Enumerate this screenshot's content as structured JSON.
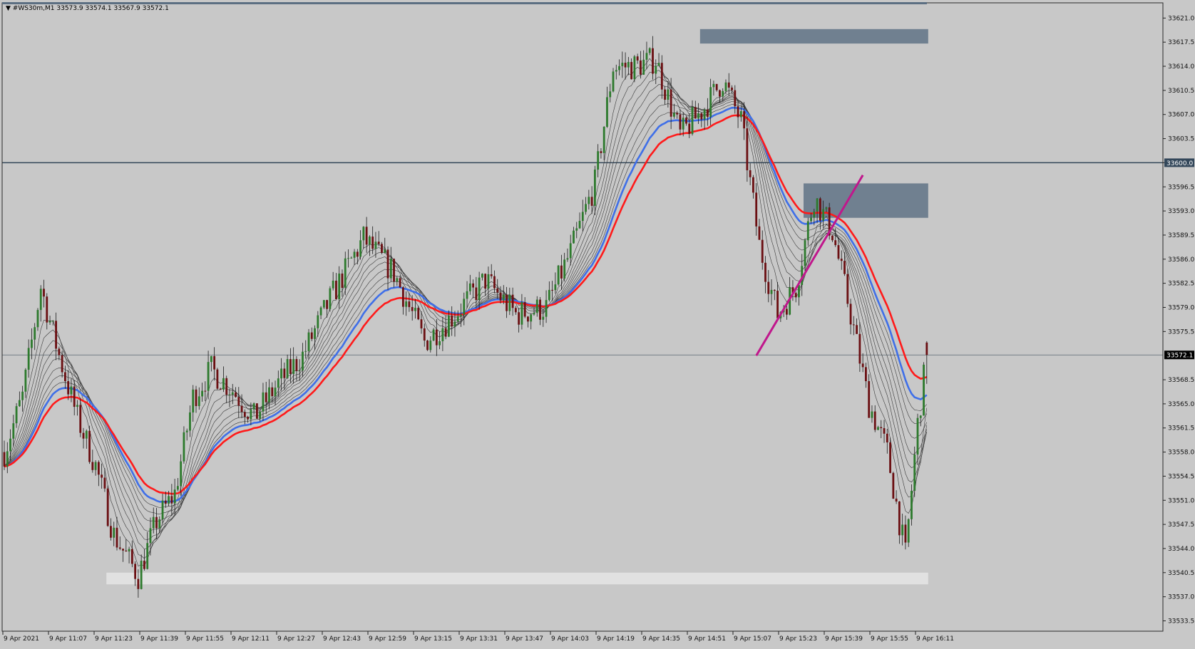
{
  "window": {
    "header": "▼ #WS30m,M1  33573.9 33574.1 33567.9 33572.1"
  },
  "price_axis": {
    "ticks": [
      "33621.0",
      "33617.5",
      "33614.0",
      "33610.5",
      "33607.0",
      "33603.5",
      "33600.0",
      "33596.5",
      "33593.0",
      "33589.5",
      "33586.0",
      "33582.5",
      "33579.0",
      "33575.5",
      "33572.1",
      "33568.5",
      "33565.0",
      "33561.5",
      "33558.0",
      "33554.5",
      "33551.0",
      "33547.5",
      "33544.0",
      "33540.5",
      "33537.0",
      "33533.5"
    ],
    "horizontal_line_label": "33600.0",
    "current_price_label": "33572.1"
  },
  "time_axis": {
    "ticks": [
      "9 Apr 2021",
      "9 Apr 11:07",
      "9 Apr 11:23",
      "9 Apr 11:39",
      "9 Apr 11:55",
      "9 Apr 12:11",
      "9 Apr 12:27",
      "9 Apr 12:43",
      "9 Apr 12:59",
      "9 Apr 13:15",
      "9 Apr 13:31",
      "9 Apr 13:47",
      "9 Apr 14:03",
      "9 Apr 14:19",
      "9 Apr 14:35",
      "9 Apr 14:51",
      "9 Apr 15:07",
      "9 Apr 15:23",
      "9 Apr 15:39",
      "9 Apr 15:55",
      "9 Apr 16:11"
    ]
  },
  "colors": {
    "background": "#c8c8c8",
    "bull_candle": "#2d7a2d",
    "bear_candle": "#6b0f12",
    "ema_red": "#ff1a1a",
    "ema_blue": "#3f6fe8",
    "ma_thin": "#3a3a3a",
    "zone": "#708090",
    "trendline": "#c0178c",
    "level_line": "#33475a",
    "support_zone": "#e1e1e1"
  },
  "chart_data": {
    "type": "candlestick",
    "symbol": "#WS30m",
    "timeframe": "M1",
    "last_bar": {
      "open": 33573.9,
      "high": 33574.1,
      "low": 33567.9,
      "close": 33572.1
    },
    "ylim": [
      33532.0,
      33623.0
    ],
    "key_points": [
      {
        "t": 0,
        "p": 33558
      },
      {
        "t": 6,
        "p": 33566
      },
      {
        "t": 12,
        "p": 33582
      },
      {
        "t": 18,
        "p": 33572
      },
      {
        "t": 24,
        "p": 33563
      },
      {
        "t": 30,
        "p": 33556
      },
      {
        "t": 36,
        "p": 33546
      },
      {
        "t": 44,
        "p": 33540
      },
      {
        "t": 50,
        "p": 33548
      },
      {
        "t": 56,
        "p": 33552
      },
      {
        "t": 62,
        "p": 33566
      },
      {
        "t": 68,
        "p": 33570
      },
      {
        "t": 75,
        "p": 33567
      },
      {
        "t": 82,
        "p": 33563
      },
      {
        "t": 90,
        "p": 33568
      },
      {
        "t": 98,
        "p": 33572
      },
      {
        "t": 108,
        "p": 33581
      },
      {
        "t": 118,
        "p": 33589
      },
      {
        "t": 128,
        "p": 33584
      },
      {
        "t": 138,
        "p": 33574
      },
      {
        "t": 148,
        "p": 33578
      },
      {
        "t": 158,
        "p": 33583
      },
      {
        "t": 168,
        "p": 33578
      },
      {
        "t": 178,
        "p": 33579
      },
      {
        "t": 186,
        "p": 33587
      },
      {
        "t": 194,
        "p": 33597
      },
      {
        "t": 200,
        "p": 33614
      },
      {
        "t": 207,
        "p": 33614
      },
      {
        "t": 214,
        "p": 33615
      },
      {
        "t": 222,
        "p": 33604
      },
      {
        "t": 230,
        "p": 33608
      },
      {
        "t": 236,
        "p": 33612
      },
      {
        "t": 242,
        "p": 33606
      },
      {
        "t": 248,
        "p": 33588
      },
      {
        "t": 254,
        "p": 33578
      },
      {
        "t": 260,
        "p": 33582
      },
      {
        "t": 266,
        "p": 33595
      },
      {
        "t": 272,
        "p": 33590
      },
      {
        "t": 278,
        "p": 33578
      },
      {
        "t": 284,
        "p": 33565
      },
      {
        "t": 290,
        "p": 33558
      },
      {
        "t": 296,
        "p": 33543
      },
      {
        "t": 300,
        "p": 33562
      },
      {
        "t": 303,
        "p": 33572
      }
    ],
    "overlays": {
      "zones": [
        {
          "name": "supply-zone-upper",
          "price_top": 33619.4,
          "price_bottom": 33617.3,
          "from_bar": 229,
          "to_bar": 303
        },
        {
          "name": "supply-zone-mid",
          "price_top": 33597.0,
          "price_bottom": 33592.0,
          "from_bar": 263,
          "to_bar": 303
        },
        {
          "name": "support-zone",
          "price_top": 33540.5,
          "price_bottom": 33538.8,
          "from_bar": 34,
          "to_bar": 303
        }
      ],
      "horizontal_level": 33600.0,
      "current_price": 33572.1,
      "trendline": {
        "from": {
          "bar": 247,
          "price": 33572.0
        },
        "to": {
          "bar": 282,
          "price": 33598.2
        }
      }
    },
    "grid": false
  }
}
